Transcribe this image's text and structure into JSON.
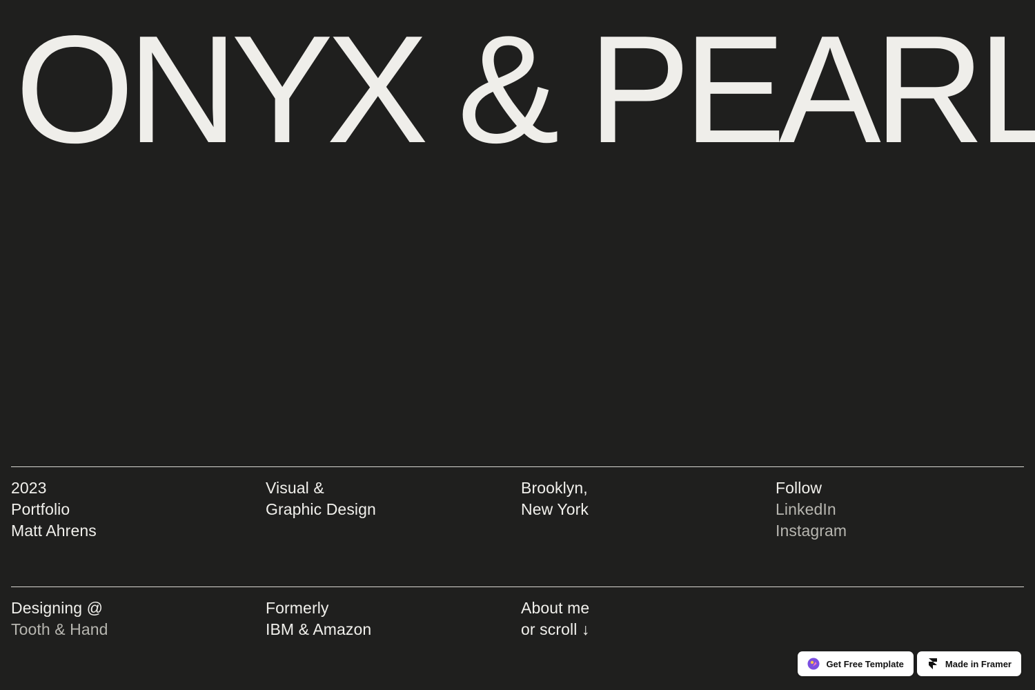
{
  "hero": {
    "title": "ONYX & PEARL"
  },
  "info_row": {
    "col1": [
      "2023",
      "Portfolio",
      "Matt Ahrens"
    ],
    "col2": [
      "Visual &",
      "Graphic Design"
    ],
    "col3": [
      "Brooklyn,",
      "New York"
    ],
    "col4": {
      "heading": "Follow",
      "links": [
        "LinkedIn",
        "Instagram"
      ]
    }
  },
  "detail_row": {
    "col1": {
      "label": "Designing @",
      "link": "Tooth & Hand"
    },
    "col2": [
      "Formerly",
      "IBM & Amazon"
    ],
    "col3": [
      "About me",
      "or scroll ↓"
    ]
  },
  "badges": {
    "template_label": "Get Free Template",
    "framer_label": "Made in Framer"
  },
  "colors": {
    "background": "#1f1f1e",
    "text": "#f1f0ec",
    "muted_link": "#b7b6b0",
    "badge_bg": "#ffffff",
    "template_icon": "#7b4fe0"
  },
  "icons": {
    "template": "template-logo-icon",
    "framer": "framer-logo-icon"
  }
}
